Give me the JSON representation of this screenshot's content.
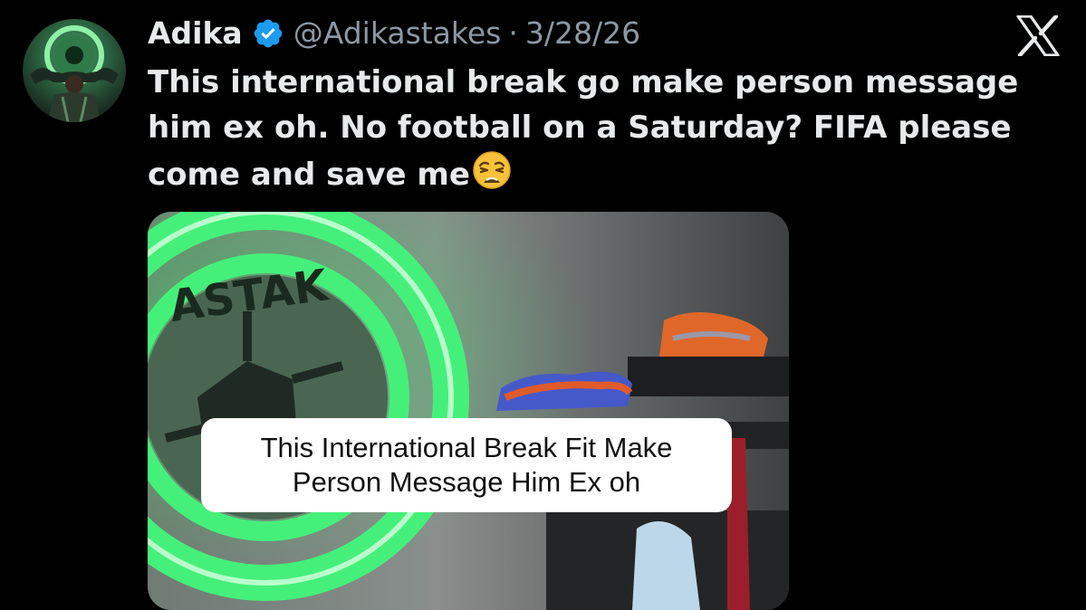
{
  "tweet": {
    "author": {
      "display_name": "Adika",
      "handle": "@Adikastakes",
      "verified": true
    },
    "separator": "·",
    "date": "3/28/26",
    "text": "This international break go make person message him ex oh. No football on a Saturday? FIFA please come and save me",
    "emoji": "weary-face",
    "media": {
      "caption_line_1": "This International Break Fit Make",
      "caption_line_2": "Person Message Him Ex oh",
      "logo_text": "ASTAK"
    }
  },
  "platform_icon": "x-logo",
  "colors": {
    "background": "#000000",
    "text": "#e7e9ea",
    "secondary_text": "#8b98a5",
    "verified_badge": "#1d9bf0",
    "logo_green": "#3ddc64"
  }
}
